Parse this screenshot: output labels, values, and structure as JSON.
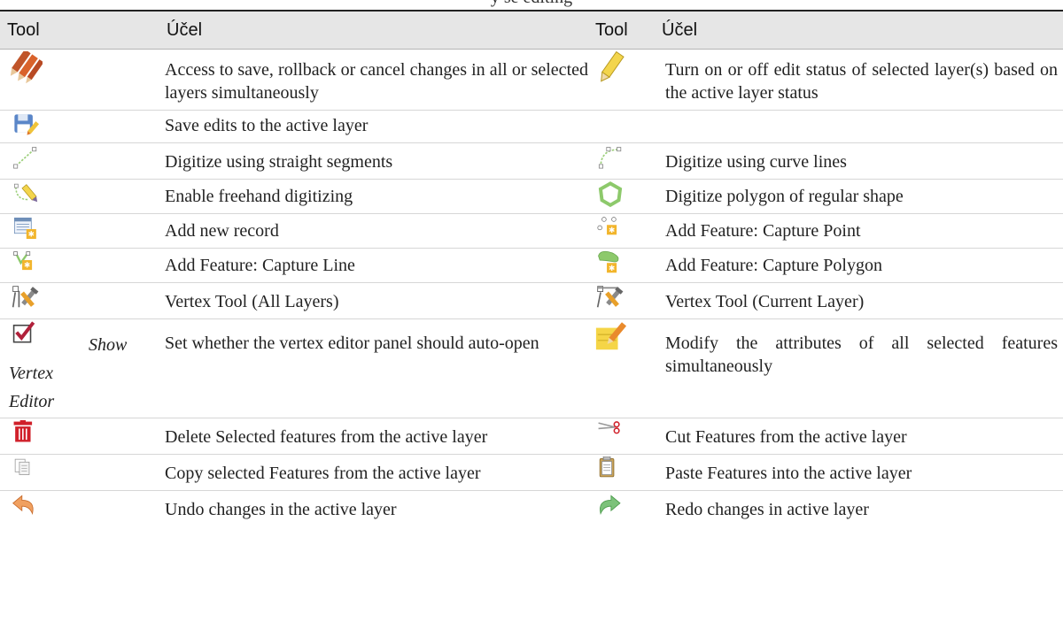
{
  "caption": "y se editing",
  "headers": {
    "tool": "Tool",
    "purpose": "Účel",
    "tool2": "Tool",
    "purpose2": "Účel"
  },
  "rows": [
    {
      "left_icon": "pencils-icon",
      "left_text": "Access to save, rollback or cancel changes in all or selected layers simultaneously",
      "right_icon": "pencil-icon",
      "right_text": "Turn on or off edit status of selected layer(s) based on the active layer status"
    },
    {
      "left_icon": "save-edits-icon",
      "left_text": "Save edits to the active layer",
      "right_icon": "",
      "right_text": ""
    },
    {
      "left_icon": "straight-segments-icon",
      "left_text": "Digitize using straight segments",
      "right_icon": "curve-lines-icon",
      "right_text": "Digitize using curve lines"
    },
    {
      "left_icon": "freehand-icon",
      "left_text": "Enable freehand digitizing",
      "right_icon": "regular-polygon-icon",
      "right_text": "Digitize polygon of regular shape"
    },
    {
      "left_icon": "new-record-icon",
      "left_text": "Add new record",
      "right_icon": "capture-point-icon",
      "right_text": "Add Feature: Capture Point"
    },
    {
      "left_icon": "capture-line-icon",
      "left_text": "Add Feature: Capture Line",
      "right_icon": "capture-polygon-icon",
      "right_text": "Add Feature: Capture Polygon"
    },
    {
      "left_icon": "vertex-tool-all-icon",
      "left_text": "Vertex Tool (All Layers)",
      "right_icon": "vertex-tool-current-icon",
      "right_text": "Vertex Tool (Current Layer)"
    },
    {
      "left_icon": "checkbox-icon",
      "left_label": "Show Vertex Editor",
      "left_label_parts": [
        "Show",
        "Vertex",
        "Editor"
      ],
      "left_text": "Set whether the vertex editor panel should auto-open",
      "right_icon": "modify-attributes-icon",
      "right_text": "Modify the attributes of all selected features simultaneously"
    },
    {
      "left_icon": "delete-icon",
      "left_text": "Delete Selected features from the active layer",
      "right_icon": "cut-icon",
      "right_text": "Cut Features from the active layer"
    },
    {
      "left_icon": "copy-icon",
      "left_text": "Copy selected Features from the active layer",
      "right_icon": "paste-icon",
      "right_text": "Paste Features into the active layer"
    },
    {
      "left_icon": "undo-icon",
      "left_text": "Undo changes in the active layer",
      "right_icon": "redo-icon",
      "right_text": "Redo changes in active layer"
    }
  ]
}
